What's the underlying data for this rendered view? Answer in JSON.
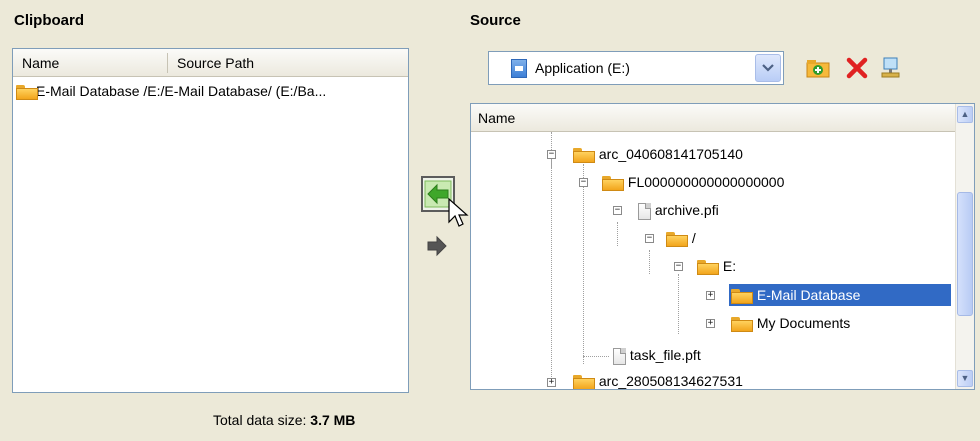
{
  "clipboard": {
    "title": "Clipboard",
    "columns": [
      "Name",
      "Source Path"
    ],
    "items": [
      {
        "name": "E-Mail Database",
        "path": "/E:/E-Mail Database/ (E:/Ba..."
      }
    ],
    "total_label": "Total data size:",
    "total_value": "3.7 MB"
  },
  "source": {
    "title": "Source",
    "dropdown_value": "Application (E:)",
    "column_name": "Name",
    "tree": [
      {
        "label": "arc_040608141705140",
        "icon": "folder"
      },
      {
        "label": "FL000000000000000000",
        "icon": "folder"
      },
      {
        "label": "archive.pfi",
        "icon": "file"
      },
      {
        "label": "/",
        "icon": "folder"
      },
      {
        "label": "E:",
        "icon": "folder"
      },
      {
        "label": "E-Mail Database",
        "icon": "folder",
        "selected": true
      },
      {
        "label": "My Documents",
        "icon": "folder"
      },
      {
        "label": "task_file.pft",
        "icon": "file"
      },
      {
        "label": "arc_280508134627531",
        "icon": "folder"
      }
    ]
  },
  "colors": {
    "selection": "#316ac5",
    "border": "#7f9db9"
  },
  "icons": {
    "new_folder": "new-folder-icon",
    "delete": "delete-icon",
    "properties": "properties-icon",
    "add_to_clipboard": "arrow-left-icon",
    "remove_from_clipboard": "arrow-right-icon"
  }
}
